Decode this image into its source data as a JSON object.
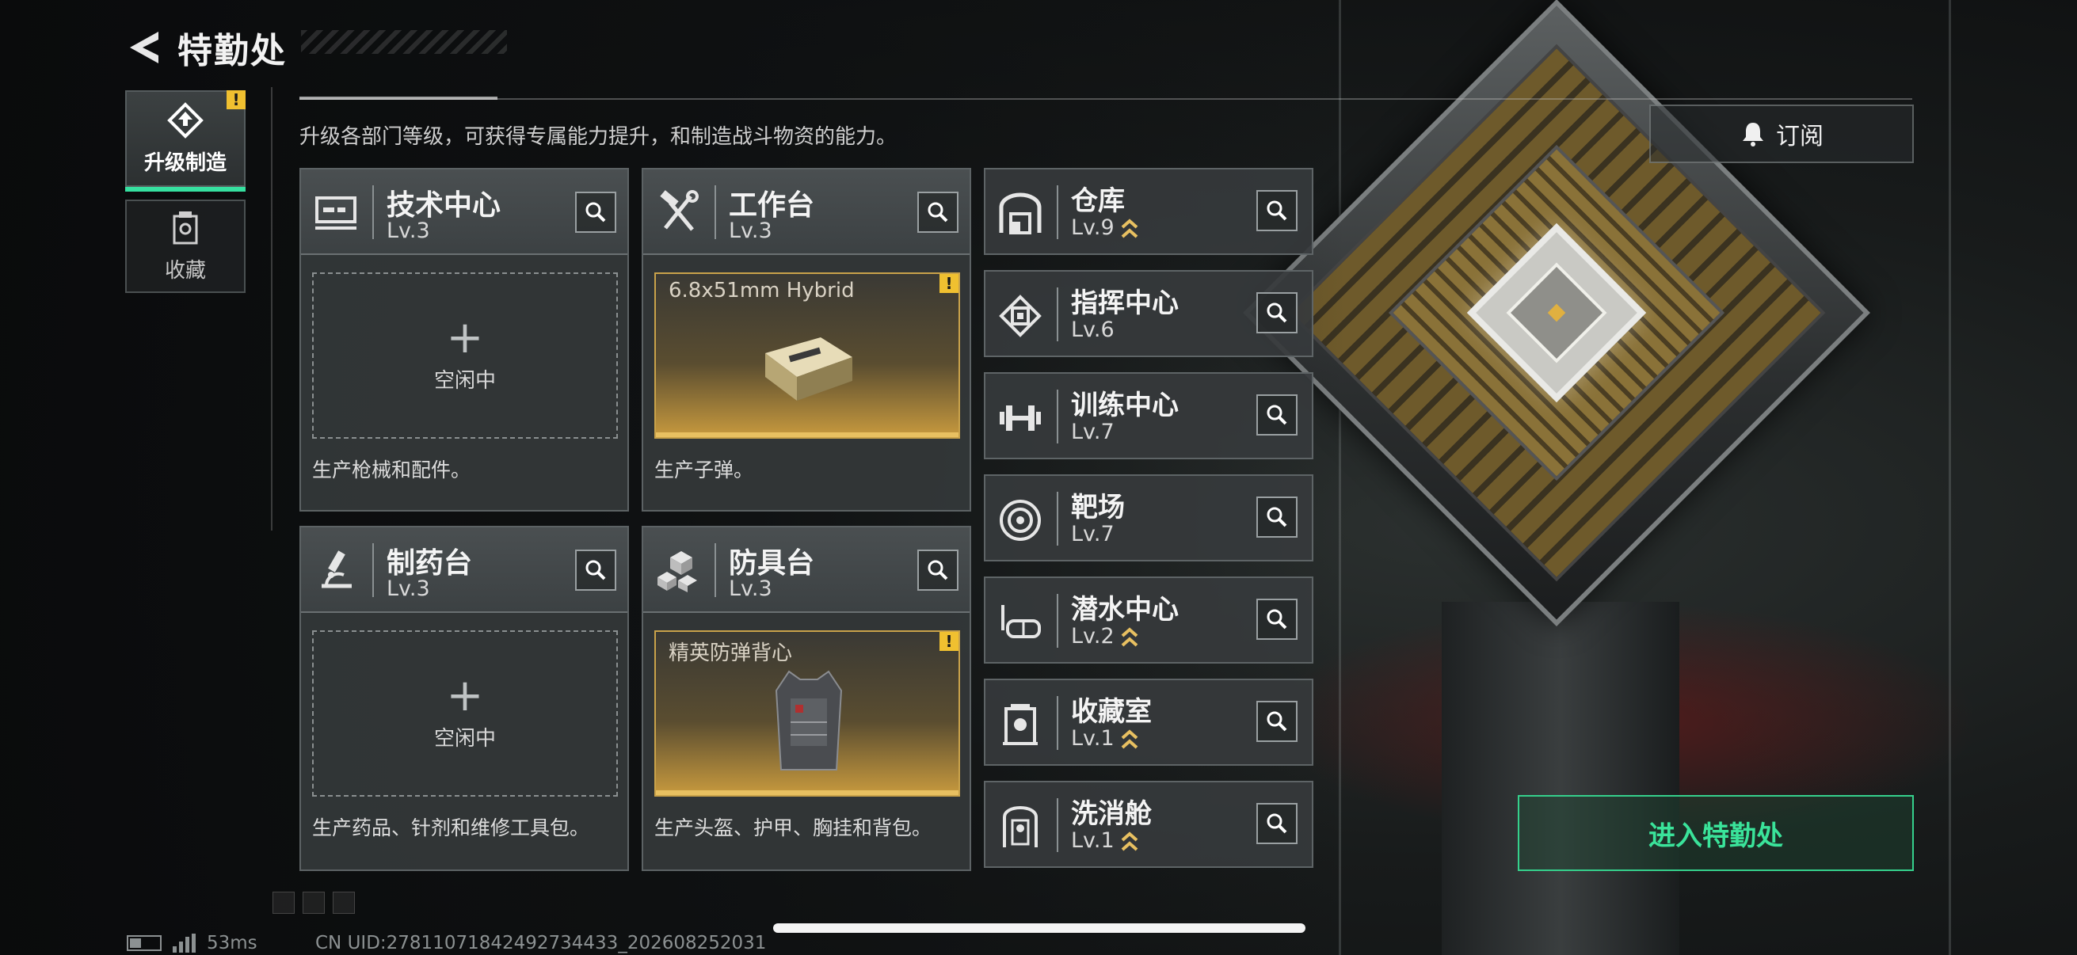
{
  "header": {
    "title": "特勤处"
  },
  "sidebar": {
    "items": [
      {
        "label": "升级制造",
        "active": true,
        "warning": "!"
      },
      {
        "label": "收藏",
        "active": false
      }
    ]
  },
  "description": "升级各部门等级，可获得专属能力提升，和制造战斗物资的能力。",
  "subscribe_label": "订阅",
  "cards": [
    {
      "name": "技术中心",
      "level": "Lv.3",
      "icon": "monitor-icon",
      "slot_state": "empty",
      "slot_text": "空闲中",
      "desc": "生产枪械和配件。"
    },
    {
      "name": "工作台",
      "level": "Lv.3",
      "icon": "hammer-wrench-icon",
      "slot_state": "busy",
      "slot_item": "6.8x51mm Hybrid",
      "warning": "!",
      "desc": "生产子弹。"
    },
    {
      "name": "制药台",
      "level": "Lv.3",
      "icon": "microscope-icon",
      "slot_state": "empty",
      "slot_text": "空闲中",
      "desc": "生产药品、针剂和维修工具包。"
    },
    {
      "name": "防具台",
      "level": "Lv.3",
      "icon": "armor-cubes-icon",
      "slot_state": "busy",
      "slot_item": "精英防弹背心",
      "warning": "!",
      "desc": "生产头盔、护甲、胸挂和背包。"
    }
  ],
  "facilities": [
    {
      "name": "仓库",
      "level": "Lv.9",
      "upgradeable": true,
      "icon": "warehouse-icon"
    },
    {
      "name": "指挥中心",
      "level": "Lv.6",
      "upgradeable": false,
      "icon": "chip-icon"
    },
    {
      "name": "训练中心",
      "level": "Lv.7",
      "upgradeable": false,
      "icon": "dumbbell-icon"
    },
    {
      "name": "靶场",
      "level": "Lv.7",
      "upgradeable": false,
      "icon": "target-icon"
    },
    {
      "name": "潜水中心",
      "level": "Lv.2",
      "upgradeable": true,
      "icon": "diving-mask-icon"
    },
    {
      "name": "收藏室",
      "level": "Lv.1",
      "upgradeable": true,
      "icon": "collection-room-icon"
    },
    {
      "name": "洗消舱",
      "level": "Lv.1",
      "upgradeable": true,
      "icon": "decon-chamber-icon"
    }
  ],
  "enter_button": "进入特勤处",
  "status": {
    "ping": "53ms",
    "uid": "CN UID:27811071842492734433_202608252031"
  },
  "colors": {
    "accent_green": "#3ae39a",
    "warning_yellow": "#f0c030",
    "busy_gold": "#c9a24a"
  }
}
